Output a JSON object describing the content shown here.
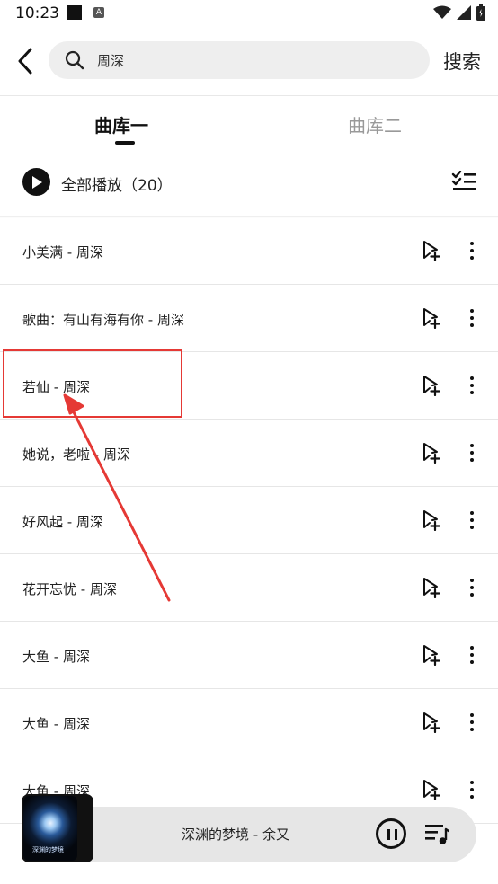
{
  "status_bar": {
    "time": "10:23",
    "notification_badge": "A",
    "icons": [
      "square-notification-icon",
      "a-badge-icon",
      "wifi-icon",
      "signal-icon",
      "battery-icon"
    ]
  },
  "search": {
    "query": "周深",
    "submit_label": "搜索"
  },
  "tabs": [
    {
      "label": "曲库一",
      "active": true
    },
    {
      "label": "曲库二",
      "active": false
    }
  ],
  "play_all": {
    "label": "全部播放（20）"
  },
  "songs": [
    {
      "title": "小美满 - 周深"
    },
    {
      "title": "歌曲：有山有海有你 - 周深"
    },
    {
      "title": "若仙 - 周深"
    },
    {
      "title": "她说，老啦 - 周深"
    },
    {
      "title": "好风起 - 周深"
    },
    {
      "title": "花开忘忧 - 周深"
    },
    {
      "title": "大鱼 - 周深"
    },
    {
      "title": "大鱼 - 周深"
    },
    {
      "title": "大鱼 - 周深"
    }
  ],
  "now_playing": {
    "title": "深渊的梦境 - 余又",
    "album_text": "深渊的梦境",
    "state": "playing"
  },
  "colors": {
    "annotation": "#e53935",
    "accent": "#111111",
    "search_bg": "#eeeeee",
    "player_bg": "#e6e6e6"
  }
}
